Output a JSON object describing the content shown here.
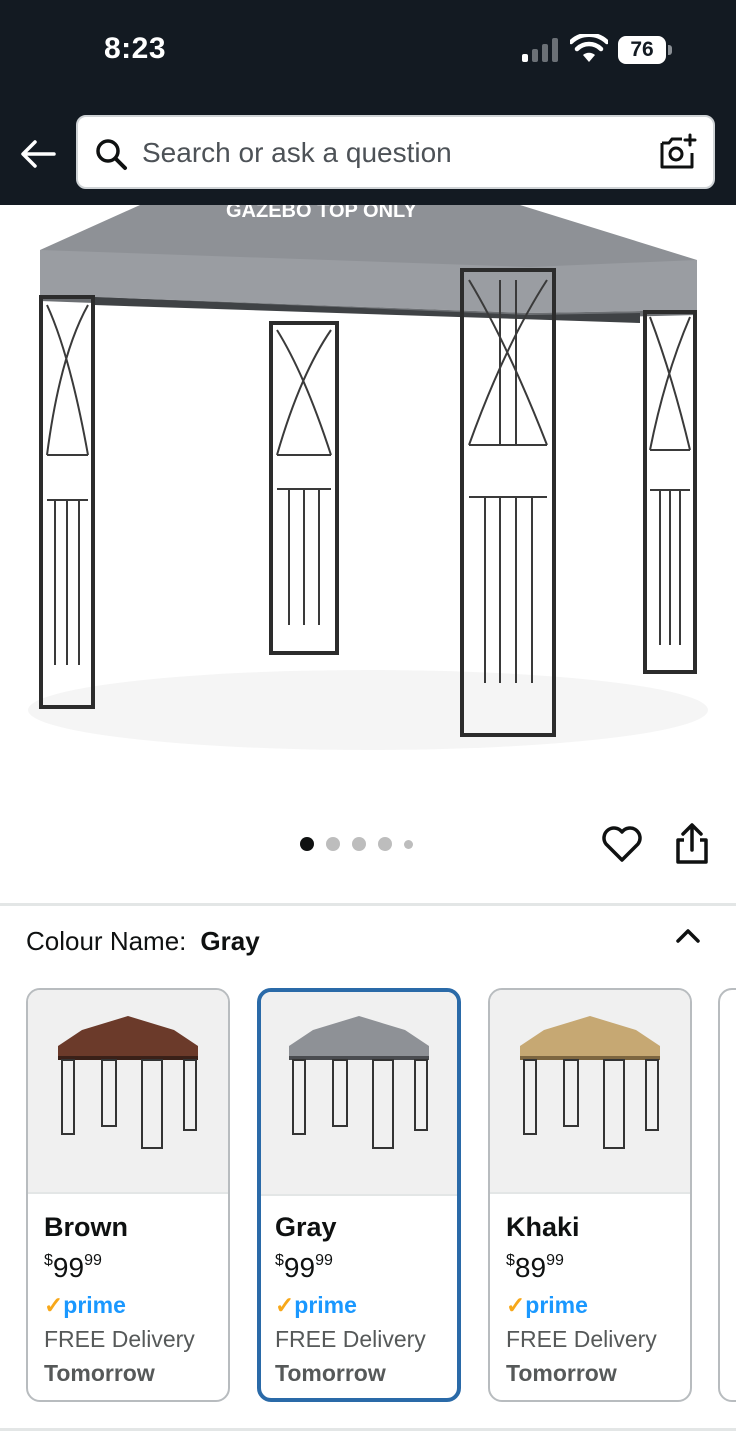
{
  "status_bar": {
    "time": "8:23",
    "battery": "76"
  },
  "header": {
    "search_placeholder": "Search or ask a question"
  },
  "product_image": {
    "canopy_text": "GAZEBO TOP ONLY",
    "carousel_total": 5,
    "carousel_active": 1
  },
  "colour": {
    "label": "Colour Name:",
    "selected": "Gray"
  },
  "swatches": [
    {
      "name": "Brown",
      "currency": "$",
      "price_whole": "99",
      "price_fraction": "99",
      "prime": "prime",
      "delivery": "FREE Delivery",
      "when": "Tomorrow",
      "canopy_color": "#6b3a2a"
    },
    {
      "name": "Gray",
      "currency": "$",
      "price_whole": "99",
      "price_fraction": "99",
      "prime": "prime",
      "delivery": "FREE Delivery",
      "when": "Tomorrow",
      "canopy_color": "#8e9196"
    },
    {
      "name": "Khaki",
      "currency": "$",
      "price_whole": "89",
      "price_fraction": "99",
      "prime": "prime",
      "delivery": "FREE Delivery",
      "when": "Tomorrow",
      "canopy_color": "#c6a873"
    }
  ],
  "colors": {
    "header_bg": "#131a22",
    "selected_border": "#2a6aa8",
    "prime_blue": "#1a98ff",
    "prime_check": "#f7a81b"
  }
}
